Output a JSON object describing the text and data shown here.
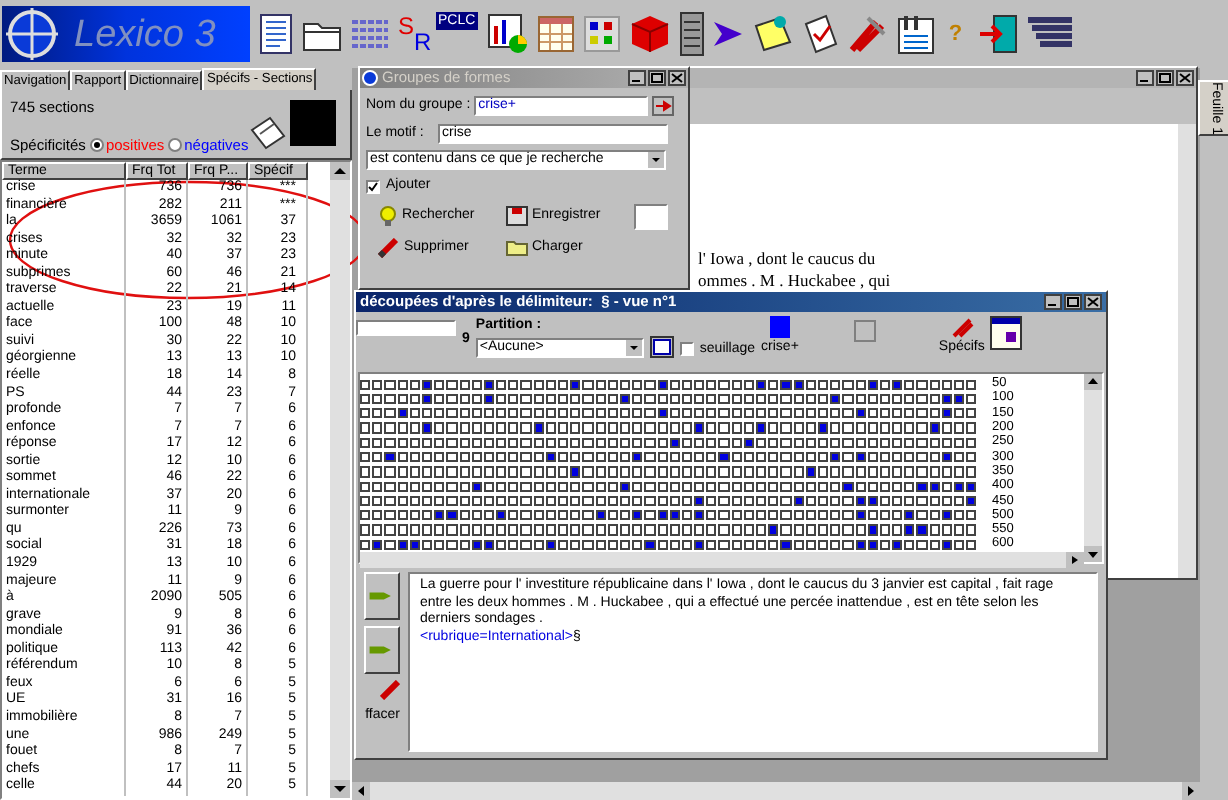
{
  "toolbar": {
    "logo": "Lexico 3",
    "sr_letters": [
      "S",
      "R"
    ],
    "pclc": "PCLC",
    "help": "?"
  },
  "left_panel": {
    "tabs": [
      {
        "label": "Navigation",
        "selected": false
      },
      {
        "label": "Rapport",
        "selected": false
      },
      {
        "label": "Dictionnaire",
        "selected": false
      },
      {
        "label": "Spécifs - Sections",
        "selected": true
      }
    ],
    "sections_count": "745 sections",
    "specificites": {
      "label": "Spécificités",
      "options": [
        {
          "label": "positives",
          "selected": true,
          "color": "#ff0000"
        },
        {
          "label": "négatives",
          "selected": false,
          "color": "#0000ff"
        }
      ]
    },
    "table": {
      "columns": [
        "Terme",
        "Frq Tot",
        "Frq P...",
        "Spécif"
      ],
      "rows": [
        [
          "crise",
          "736",
          "736",
          "***"
        ],
        [
          "financière",
          "282",
          "211",
          "***"
        ],
        [
          "la",
          "3659",
          "1061",
          "37"
        ],
        [
          "crises",
          "32",
          "32",
          "23"
        ],
        [
          "minute",
          "40",
          "37",
          "23"
        ],
        [
          "subprimes",
          "60",
          "46",
          "21"
        ],
        [
          "traverse",
          "22",
          "21",
          "14"
        ],
        [
          "actuelle",
          "23",
          "19",
          "11"
        ],
        [
          "face",
          "100",
          "48",
          "10"
        ],
        [
          "suivi",
          "30",
          "22",
          "10"
        ],
        [
          "géorgienne",
          "13",
          "13",
          "10"
        ],
        [
          "réelle",
          "18",
          "14",
          "8"
        ],
        [
          "PS",
          "44",
          "23",
          "7"
        ],
        [
          "profonde",
          "7",
          "7",
          "6"
        ],
        [
          "enfonce",
          "7",
          "7",
          "6"
        ],
        [
          "réponse",
          "17",
          "12",
          "6"
        ],
        [
          "sortie",
          "12",
          "10",
          "6"
        ],
        [
          "sommet",
          "46",
          "22",
          "6"
        ],
        [
          "internationale",
          "37",
          "20",
          "6"
        ],
        [
          "surmonter",
          "11",
          "9",
          "6"
        ],
        [
          "qu",
          "226",
          "73",
          "6"
        ],
        [
          "social",
          "31",
          "18",
          "6"
        ],
        [
          "1929",
          "13",
          "10",
          "6"
        ],
        [
          "majeure",
          "11",
          "9",
          "6"
        ],
        [
          "à",
          "2090",
          "505",
          "6"
        ],
        [
          "grave",
          "9",
          "8",
          "6"
        ],
        [
          "mondiale",
          "91",
          "36",
          "6"
        ],
        [
          "politique",
          "113",
          "42",
          "6"
        ],
        [
          "référendum",
          "10",
          "8",
          "5"
        ],
        [
          "feux",
          "6",
          "6",
          "5"
        ],
        [
          "UE",
          "31",
          "16",
          "5"
        ],
        [
          "immobilière",
          "8",
          "7",
          "5"
        ],
        [
          "une",
          "986",
          "249",
          "5"
        ],
        [
          "fouet",
          "8",
          "7",
          "5"
        ],
        [
          "chefs",
          "17",
          "11",
          "5"
        ],
        [
          "celle",
          "44",
          "20",
          "5"
        ]
      ]
    }
  },
  "document_window": {
    "lines": [
      "l' Iowa , dont le caucus du",
      "ommes . M . Huckabee , qui"
    ]
  },
  "group_dialog": {
    "title": "Groupes de formes",
    "name_label": "Nom du groupe :",
    "name_value": "crise+",
    "motif_label": "Le motif :",
    "motif_value": "crise",
    "mode": "est contenu dans ce que je recherche",
    "ajouter": {
      "label": "Ajouter",
      "checked": true
    },
    "buttons": [
      {
        "label": "Rechercher",
        "kind": "search"
      },
      {
        "label": "Enregistrer",
        "kind": "save"
      },
      {
        "label": "Supprimer",
        "kind": "delete"
      },
      {
        "label": "Charger",
        "kind": "load"
      }
    ]
  },
  "sections_window": {
    "title": "découpées d'après le délimiteur:  § - vue n°1",
    "count": "9",
    "partition_label": "Partition :",
    "partition_value": "<Aucune>",
    "seuillage": {
      "label": "seuillage",
      "checked": false
    },
    "groups": [
      {
        "label": "crise+",
        "color": "#0000ff"
      }
    ],
    "specifs": "Spécifs",
    "grid": {
      "rows": [
        {
          "label": "50",
          "cells": [
            false,
            false,
            false,
            false,
            false,
            true,
            false,
            false,
            false,
            false,
            true,
            false,
            false,
            false,
            false,
            false,
            false,
            true,
            false,
            false,
            false,
            false,
            false,
            false,
            true,
            false,
            false,
            false,
            false,
            false,
            false,
            false,
            true,
            false,
            true,
            true,
            false,
            false,
            false,
            false,
            false,
            true,
            false,
            true,
            false,
            false,
            false,
            false,
            false,
            false
          ]
        },
        {
          "label": "100",
          "cells": [
            false,
            false,
            false,
            false,
            false,
            true,
            false,
            false,
            false,
            false,
            true,
            false,
            false,
            false,
            false,
            false,
            false,
            false,
            false,
            false,
            false,
            true,
            false,
            false,
            false,
            false,
            false,
            false,
            false,
            false,
            false,
            false,
            false,
            false,
            false,
            false,
            false,
            false,
            true,
            false,
            false,
            false,
            false,
            false,
            false,
            false,
            false,
            true,
            true,
            false
          ]
        },
        {
          "label": "150",
          "cells": [
            false,
            false,
            false,
            true,
            false,
            false,
            false,
            false,
            false,
            false,
            false,
            false,
            false,
            false,
            false,
            false,
            false,
            false,
            false,
            false,
            false,
            false,
            false,
            false,
            true,
            false,
            false,
            false,
            false,
            false,
            false,
            false,
            false,
            false,
            false,
            false,
            false,
            false,
            false,
            false,
            true,
            false,
            false,
            false,
            false,
            false,
            false,
            true,
            false,
            false
          ]
        },
        {
          "label": "200",
          "cells": [
            false,
            false,
            false,
            false,
            false,
            true,
            false,
            false,
            false,
            false,
            false,
            false,
            false,
            false,
            true,
            false,
            false,
            false,
            false,
            false,
            false,
            false,
            false,
            false,
            false,
            false,
            false,
            true,
            false,
            false,
            false,
            false,
            true,
            false,
            false,
            false,
            false,
            true,
            false,
            false,
            false,
            false,
            false,
            false,
            false,
            false,
            true,
            false,
            false,
            false
          ]
        },
        {
          "label": "250",
          "cells": [
            false,
            false,
            false,
            false,
            false,
            false,
            false,
            false,
            false,
            false,
            false,
            false,
            false,
            false,
            false,
            false,
            false,
            false,
            false,
            false,
            false,
            false,
            false,
            false,
            false,
            true,
            false,
            false,
            false,
            false,
            false,
            true,
            false,
            false,
            false,
            false,
            false,
            false,
            false,
            false,
            false,
            false,
            false,
            false,
            false,
            false,
            false,
            false,
            false,
            false
          ]
        },
        {
          "label": "300",
          "cells": [
            false,
            false,
            true,
            false,
            false,
            false,
            false,
            false,
            false,
            false,
            false,
            false,
            false,
            false,
            false,
            true,
            false,
            false,
            false,
            false,
            false,
            false,
            true,
            false,
            false,
            false,
            false,
            false,
            false,
            true,
            false,
            false,
            false,
            false,
            false,
            false,
            false,
            false,
            true,
            false,
            true,
            false,
            false,
            false,
            false,
            false,
            false,
            true,
            false,
            false
          ]
        },
        {
          "label": "350",
          "cells": [
            false,
            false,
            false,
            false,
            false,
            false,
            false,
            false,
            false,
            false,
            false,
            false,
            false,
            false,
            false,
            false,
            false,
            true,
            false,
            false,
            false,
            false,
            false,
            false,
            false,
            false,
            false,
            false,
            false,
            false,
            false,
            false,
            false,
            false,
            false,
            false,
            true,
            false,
            false,
            false,
            false,
            false,
            false,
            false,
            false,
            false,
            false,
            false,
            false,
            false
          ]
        },
        {
          "label": "400",
          "cells": [
            false,
            false,
            false,
            false,
            false,
            false,
            false,
            false,
            false,
            true,
            false,
            false,
            false,
            false,
            false,
            false,
            false,
            false,
            false,
            false,
            false,
            true,
            false,
            false,
            false,
            false,
            false,
            false,
            false,
            false,
            false,
            false,
            false,
            false,
            false,
            false,
            false,
            false,
            false,
            true,
            false,
            false,
            false,
            false,
            false,
            true,
            true,
            false,
            true,
            true
          ]
        },
        {
          "label": "450",
          "cells": [
            false,
            false,
            false,
            false,
            false,
            false,
            false,
            false,
            false,
            false,
            false,
            false,
            false,
            false,
            false,
            false,
            false,
            false,
            false,
            false,
            false,
            false,
            false,
            false,
            false,
            false,
            false,
            true,
            false,
            false,
            false,
            false,
            false,
            false,
            false,
            true,
            false,
            false,
            false,
            false,
            true,
            true,
            false,
            false,
            false,
            false,
            false,
            false,
            false,
            true
          ]
        },
        {
          "label": "500",
          "cells": [
            false,
            false,
            false,
            false,
            false,
            false,
            true,
            true,
            false,
            false,
            false,
            true,
            false,
            false,
            false,
            false,
            false,
            false,
            false,
            true,
            false,
            false,
            true,
            false,
            true,
            true,
            false,
            true,
            false,
            false,
            false,
            false,
            false,
            false,
            false,
            false,
            false,
            false,
            false,
            false,
            true,
            false,
            false,
            false,
            true,
            false,
            false,
            true,
            false,
            false
          ]
        },
        {
          "label": "550",
          "cells": [
            false,
            false,
            false,
            false,
            false,
            false,
            false,
            false,
            false,
            false,
            false,
            false,
            false,
            false,
            false,
            false,
            false,
            false,
            false,
            false,
            false,
            false,
            false,
            false,
            false,
            false,
            false,
            false,
            false,
            false,
            false,
            false,
            false,
            true,
            false,
            false,
            false,
            false,
            false,
            false,
            false,
            true,
            false,
            false,
            true,
            true,
            false,
            false,
            false,
            false
          ]
        },
        {
          "label": "600",
          "cells": [
            false,
            true,
            false,
            true,
            true,
            false,
            false,
            false,
            false,
            true,
            true,
            false,
            false,
            false,
            false,
            true,
            false,
            false,
            false,
            false,
            false,
            false,
            false,
            true,
            false,
            false,
            false,
            true,
            false,
            false,
            false,
            false,
            false,
            false,
            true,
            false,
            false,
            false,
            false,
            false,
            true,
            true,
            false,
            true,
            false,
            false,
            false,
            true,
            false,
            false
          ]
        }
      ]
    },
    "text": {
      "sentence": "La guerre pour l' investiture républicaine dans l' Iowa , dont le caucus du 3 janvier est capital , fait rage entre les deux hommes . M . Huckabee , qui a effectué une percée inattendue , est en tête selon les derniers sondages .",
      "tag": "<rubrique=International>",
      "mark": "§"
    },
    "side_label": "ffacer"
  },
  "side_tab": "Feuille 1"
}
